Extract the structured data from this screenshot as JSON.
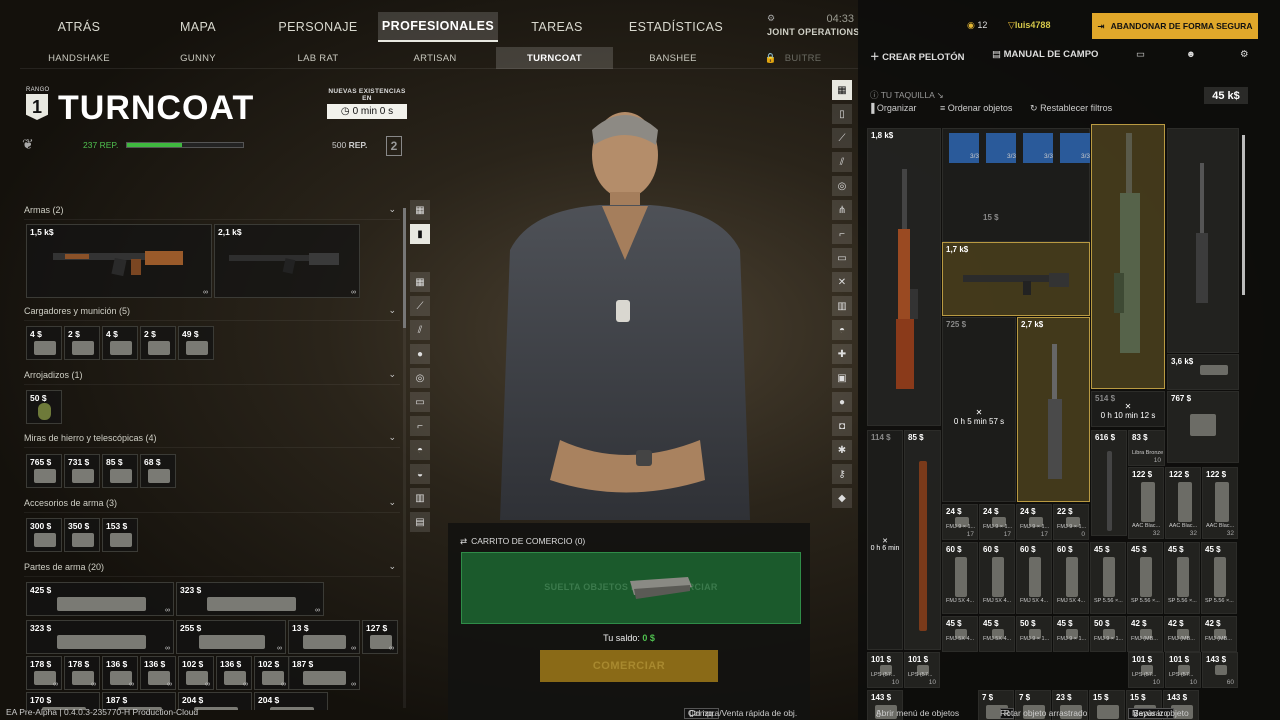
{
  "nav": {
    "tabs": [
      {
        "label": "ATRÁS",
        "active": false
      },
      {
        "label": "MAPA",
        "active": false
      },
      {
        "label": "PERSONAJE",
        "active": false
      },
      {
        "label": "PROFESIONALES",
        "active": true
      },
      {
        "label": "TAREAS",
        "active": false
      },
      {
        "label": "ESTADÍSTICAS",
        "active": false
      }
    ],
    "ops_label": "JOINT OPERATIONS",
    "clock": "04:33"
  },
  "traders": [
    {
      "label": "HANDSHAKE",
      "active": false,
      "locked": false
    },
    {
      "label": "GUNNY",
      "active": false,
      "locked": false
    },
    {
      "label": "LAB RAT",
      "active": false,
      "locked": false
    },
    {
      "label": "ARTISAN",
      "active": false,
      "locked": false
    },
    {
      "label": "TURNCOAT",
      "active": true,
      "locked": false
    },
    {
      "label": "BANSHEE",
      "active": false,
      "locked": false
    },
    {
      "label": "BUITRE",
      "active": false,
      "locked": true
    }
  ],
  "trader": {
    "rank_label": "RANGO",
    "rank": "1",
    "name": "TURNCOAT",
    "restock_label": "NUEVAS EXISTENCIAS EN",
    "restock_time": "0 min 0 s",
    "rep_current": "237",
    "rep_unit": "REP.",
    "rep_max": "500",
    "rep_progress": 0.474,
    "next_rank": "2"
  },
  "categories": [
    {
      "label": "Armas (2)"
    },
    {
      "label": "Cargadores y munición (5)"
    },
    {
      "label": "Arrojadizos (1)"
    },
    {
      "label": "Miras de hierro y telescópicas (4)"
    },
    {
      "label": "Accesorios de arma (3)"
    },
    {
      "label": "Partes de arma (20)"
    }
  ],
  "items": {
    "weapons": [
      {
        "price": "1,5 k$",
        "qty": "∞"
      },
      {
        "price": "2,1 k$",
        "qty": "∞"
      }
    ],
    "mags": [
      "4 $",
      "2 $",
      "4 $",
      "2 $",
      "49 $"
    ],
    "throwables": [
      "50 $"
    ],
    "sights": [
      "765 $",
      "731 $",
      "85 $",
      "68 $"
    ],
    "accessories": [
      "300 $",
      "350 $",
      "153 $"
    ],
    "parts_row1": [
      "425 $",
      "323 $"
    ],
    "parts_row2": [
      "323 $",
      "255 $",
      "13 $",
      "127 $"
    ],
    "parts_row3": [
      "178 $",
      "178 $",
      "136 $",
      "136 $",
      "102 $",
      "136 $",
      "102 $",
      "187 $"
    ],
    "parts_row4": [
      "170 $",
      "187 $",
      "204 $",
      "204 $"
    ]
  },
  "cart": {
    "title": "CARRITO DE COMERCIO (0)",
    "drop_text": "SUELTA OBJETOS PARA COMERCIAR",
    "balance_label": "Tu saldo:",
    "balance_value": "0 $",
    "trade_button": "COMERCIAR"
  },
  "right": {
    "level": "12",
    "username": "luis4788",
    "abandon": "ABANDONAR DE FORMA SEGURA",
    "create_squad": "CREAR PELOTÓN",
    "field_manual": "MANUAL DE CAMPO",
    "stash_label": "TU TAQUILLA",
    "stash_value": "45 k$",
    "organize": "Organizar",
    "sort": "Ordenar objetos",
    "reset": "Restablecer filtros"
  },
  "stash_items": {
    "sniper": "1,8 k$",
    "rifle_gold_a": "1,7 k$",
    "mag_dim": "15 $",
    "rifle_dim": "725 $",
    "rifle_timer": "0 h 5 min 57 s",
    "rifle_b": "2,7 k$",
    "pistol_a": "3,6 k$",
    "rifle_c_dim": "514 $",
    "timer_c": "0 h 10 min 12 s",
    "pistol_b": "767 $",
    "shotgun_dim": "114 $",
    "shotgun_timer": "0 h 6 min",
    "rifle_d": "85 $",
    "sks": "616 $",
    "ammo_libra": "83 $",
    "ammo_libra_name": "Libra Bronze",
    "ammo_libra_qty": "10",
    "aac": [
      "122 $",
      "122 $",
      "122 $"
    ],
    "aac_name": "AAC Blac...",
    "aac_qty": "32",
    "fmj_row": [
      "24 $",
      "24 $",
      "24 $",
      "22 $"
    ],
    "fmj_name": "FMJ 9 × 1...",
    "fmj_qty": [
      "17",
      "17",
      "17",
      "0"
    ],
    "row_60": [
      "60 $",
      "60 $",
      "60 $",
      "60 $",
      "45 $",
      "45 $",
      "45 $",
      "45 $"
    ],
    "row_60_names": [
      "FMJ 5X 4...",
      "FMJ 5X 4...",
      "FMJ 5X 4...",
      "FMJ 5X 4...",
      "SP 5.56 ×...",
      "SP 5.56 ×...",
      "SP 5.56 ×...",
      "SP 5.56 ×..."
    ],
    "row_45": [
      "45 $",
      "45 $",
      "50 $",
      "45 $",
      "50 $",
      "42 $",
      "42 $",
      "42 $"
    ],
    "row_45_names": [
      "FMJ 5X 4...",
      "FMJ 5X 4...",
      "FMJ 9 × 1...",
      "FMJ 9 × 1...",
      "FMJ 9 × 1...",
      "FMJ (MB...",
      "FMJ (MB...",
      "FMJ (MB..."
    ],
    "row_101": [
      "101 $",
      "101 $",
      "101 $",
      "101 $",
      "143 $"
    ],
    "row_101_names": [
      "LPS (57...",
      "LPS (57...",
      "LPS (57...",
      "LPS (57...",
      ""
    ],
    "row_101_qty": [
      "10",
      "10",
      "10",
      "10",
      "60"
    ],
    "row_143": [
      "143 $",
      "7 $",
      "7 $",
      "23 $",
      "15 $",
      "15 $",
      "143 $"
    ],
    "badges": [
      "3/3",
      "3/3",
      "3/3",
      "3/3"
    ]
  },
  "footer": {
    "build": "EA Pre-Alpha | 0.4.0.3-235770-H Production-Cloud",
    "hint1_key": "Ctrl izq.",
    "hint1": "Compra/Venta rápida de obj.",
    "hint2": "Abrir menú de objetos",
    "hint3_key": "R",
    "hint3": "Rotar objeto arrastrado",
    "hint4_key": "Mayús izq.",
    "hint4": "Separar objeto"
  }
}
